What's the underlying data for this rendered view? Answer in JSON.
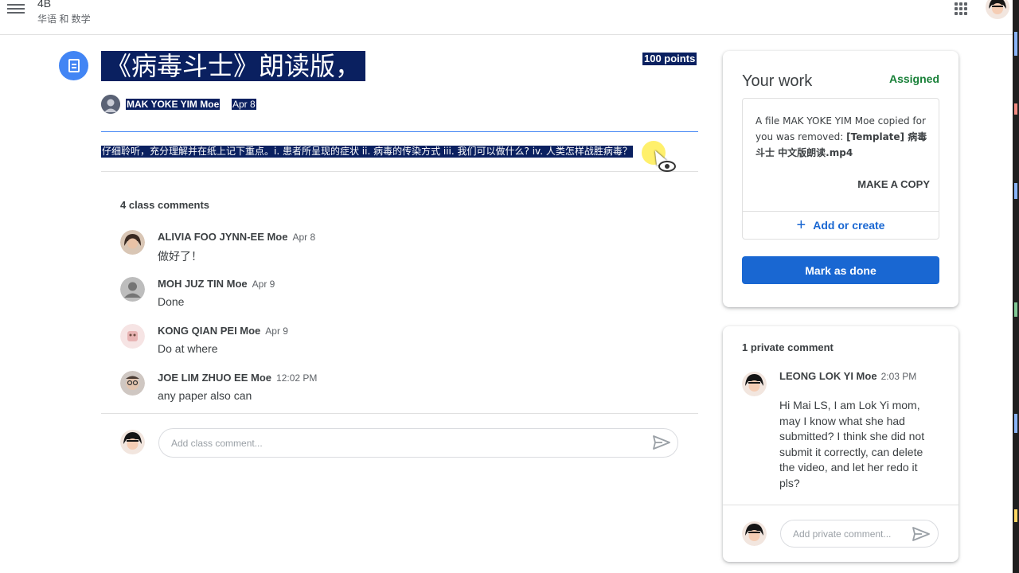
{
  "topbar": {
    "class_name": "4B",
    "class_subtitle": "华语 和 数学"
  },
  "assignment": {
    "title": "《病毒斗士》朗读版，",
    "points": "100 points",
    "author": "MAK YOKE YIM Moe",
    "date": "Apr 8",
    "instructions": "仔细聆听，充分理解并在纸上记下重点。i. 患者所呈现的症状 ii. 病毒的传染方式 iii. 我们可以做什么? iv. 人类怎样战胜病毒？"
  },
  "class_comments": {
    "header": "4 class comments",
    "items": [
      {
        "name": "ALIVIA FOO JYNN-EE Moe",
        "time": "Apr 8",
        "text": "做好了！"
      },
      {
        "name": "MOH JUZ TIN Moe",
        "time": "Apr 9",
        "text": "Done"
      },
      {
        "name": "KONG QIAN PEI Moe",
        "time": "Apr 9",
        "text": "Do at where"
      },
      {
        "name": "JOE LIM ZHUO EE Moe",
        "time": "12:02 PM",
        "text": "any paper also can"
      }
    ],
    "input_placeholder": "Add class comment..."
  },
  "your_work": {
    "title": "Your work",
    "status": "Assigned",
    "file_message_prefix": "A file MAK YOKE YIM Moe copied for you was removed: ",
    "file_name": "[Template] 病毒斗士 中文版朗读.mp4",
    "make_copy_label": "MAKE A COPY",
    "add_create_label": "Add or create",
    "mark_done_label": "Mark as done"
  },
  "private_comments": {
    "header": "1 private comment",
    "author": "LEONG LOK YI Moe",
    "time": "2:03 PM",
    "text": "Hi Mai LS, I am Lok Yi mom, may I know what she had submitted? I think she did not submit it correctly, can delete the video, and let her redo it pls?",
    "input_placeholder": "Add private comment..."
  },
  "colors": {
    "accent_blue": "#1967d2",
    "icon_blue": "#4285f4",
    "assigned_green": "#188038",
    "selection_navy": "#0a2060",
    "cursor_highlight": "#ffeb3b"
  },
  "icons": {
    "menu": "hamburger-menu-icon",
    "apps": "google-apps-grid-icon",
    "assignment": "assignment-doc-icon",
    "send": "send-arrow-icon",
    "add": "plus-icon"
  }
}
